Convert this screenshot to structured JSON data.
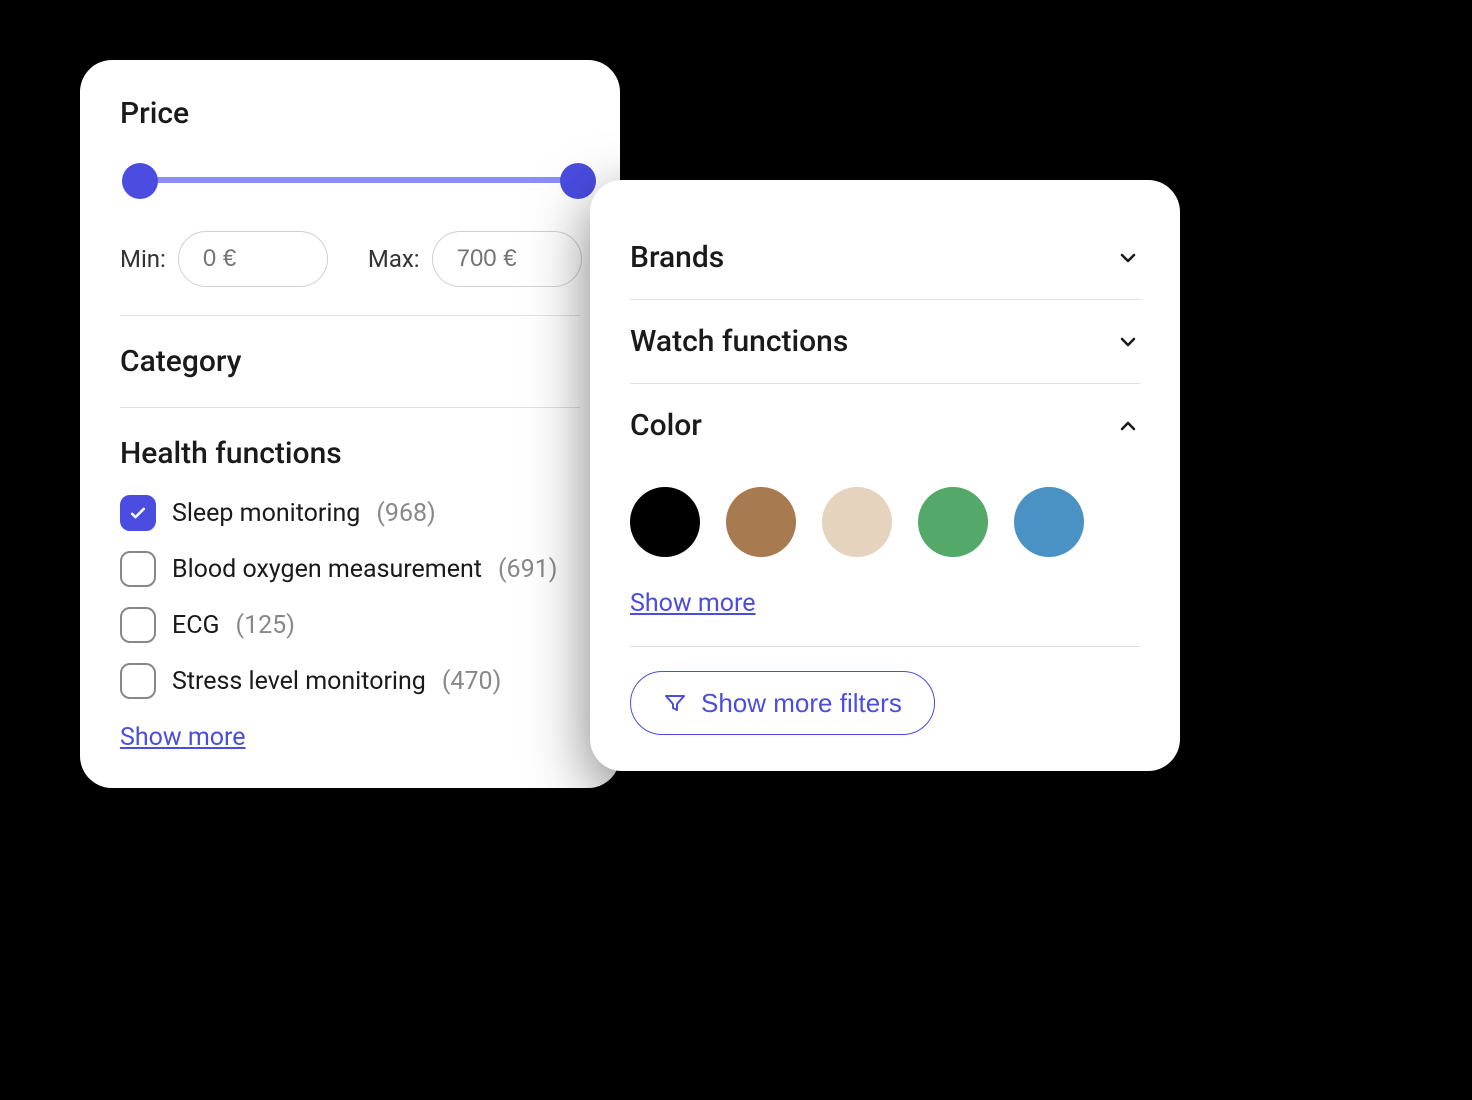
{
  "price": {
    "title": "Price",
    "min_label": "Min:",
    "max_label": "Max:",
    "min_value": "0 €",
    "max_value": "700 €"
  },
  "category": {
    "title": "Category"
  },
  "health": {
    "title": "Health functions",
    "items": [
      {
        "label": "Sleep monitoring",
        "count": "(968)",
        "checked": true
      },
      {
        "label": "Blood oxygen measurement",
        "count": "(691)",
        "checked": false
      },
      {
        "label": "ECG",
        "count": "(125)",
        "checked": false
      },
      {
        "label": "Stress level monitoring",
        "count": "(470)",
        "checked": false
      }
    ],
    "show_more": "Show more"
  },
  "brands": {
    "title": "Brands"
  },
  "watch_functions": {
    "title": "Watch functions"
  },
  "color": {
    "title": "Color",
    "swatches": [
      "#000000",
      "#a77a50",
      "#e6d3be",
      "#54a86a",
      "#4a92c4"
    ],
    "show_more": "Show more"
  },
  "show_more_filters": "Show more filters"
}
